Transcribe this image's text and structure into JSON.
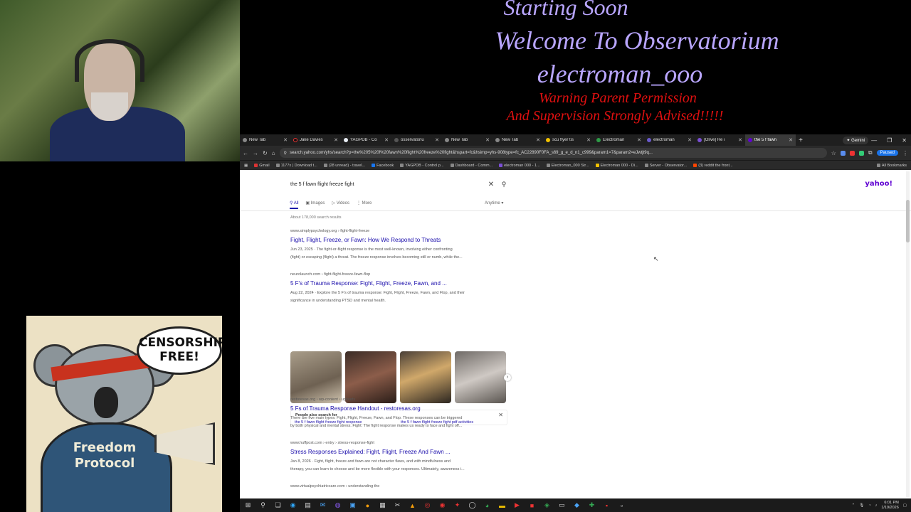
{
  "overlay": {
    "line1": "Starting Soon",
    "line2": "Welcome To Observatorium",
    "line3": "electroman_ooo",
    "line4": "Warning Parent Permission",
    "line5": "And Supervision Strongly Advised!!!!!"
  },
  "poster": {
    "bubble_line1": "CENSORSHIP",
    "bubble_line2": "FREE!",
    "hoodie_line1": "Freedom",
    "hoodie_line2": "Protocol"
  },
  "browser": {
    "tabs": [
      {
        "title": "New Tab",
        "icon": "new-tab-icon",
        "active": false
      },
      {
        "title": "Jake Davies",
        "icon": "tiktok-icon",
        "active": false
      },
      {
        "title": "YAGPDB - Co",
        "icon": "yagpdb-icon",
        "active": false
      },
      {
        "title": "osservatoriu",
        "icon": "site-icon",
        "active": false
      },
      {
        "title": "New Tab",
        "icon": "new-tab-icon",
        "active": false
      },
      {
        "title": "New Tab",
        "icon": "new-tab-icon",
        "active": false
      },
      {
        "title": "scu flyer tis",
        "icon": "yahoo-search-icon",
        "active": false
      },
      {
        "title": "Electroman",
        "icon": "site-icon",
        "active": false
      },
      {
        "title": "electroman",
        "icon": "site-icon",
        "active": false
      },
      {
        "title": "[Olive] Re i",
        "icon": "site-icon",
        "active": false
      },
      {
        "title": "the 5 f fawn",
        "icon": "yahoo-icon",
        "active": true
      }
    ],
    "gemini_label": "Gemini",
    "address": "search.yahoo.com/yhs/search?p=the%205%20f%20fawn%20flight%20freeze%20fight&hspart=fc&hsimp=yhs-908type=fc_AC22890F0FA_s69_g_e_d_n1_c999&param1=7&param2=eJwtjt9q...",
    "paused_label": "Paused",
    "bookmarks": [
      "Gmail",
      "1177x | Download t...",
      "(28 unread) - travel...",
      "Facebook",
      "YAGPDB - Control p...",
      "Dashboard - Comm...",
      "electroman 000 - 1...",
      "Electroman_000 Str...",
      "Electroman 000 - Di...",
      "Server - Observator...",
      "(3) reddit the front..."
    ],
    "all_bookmarks_label": "All Bookmarks"
  },
  "search": {
    "query": "the 5 f fawn flight freeze fight",
    "logo": "yahoo!",
    "filters": [
      "All",
      "Images",
      "Videos",
      "More"
    ],
    "anytime": "Anytime",
    "result_count": "About 178,000 search results",
    "results": [
      {
        "url": "www.simplypsychology.org › fight-flight-freeze",
        "title": "Fight, Flight, Freeze, or Fawn: How We Respond to Threats",
        "snippet1": "Jun 23, 2025 · The fight-or-flight response is the most well-known, involving either confronting",
        "snippet2": "(fight) or escaping (flight) a threat. The freeze response involves becoming still or numb, while the..."
      },
      {
        "url": "neurolaunch.com › fight-flight-freeze-fawn-flop",
        "title": "5 F's of Trauma Response: Fight, Flight, Freeze, Fawn, and ...",
        "snippet1": "Aug 22, 2024 · Explore the 5 F's of trauma response: Fight, Flight, Freeze, Fawn, and Flop, and their",
        "snippet2": "significance in understanding PTSD and mental health."
      },
      {
        "url": "restoresas.org › wp-content › uploads",
        "title": "5 Fs of Trauma Response Handout - restoresas.org",
        "snippet1": "There are five main types: Fight, Flight, Freeze, Fawn, and Flop. These responses can be triggered",
        "snippet2": "by both physical and mental stress. Fight: The fight response makes us ready to face and fight off..."
      },
      {
        "url": "www.huffpost.com › entry › stress-response-fight",
        "title": "Stress Responses Explained: Fight, Flight, Freeze And Fawn ...",
        "snippet1": "Jan 8, 2026 · Fight, flight, freeze and fawn are not character flaws, and with mindfulness and",
        "snippet2": "therapy, you can learn to choose and be more flexible with your responses. Ultimately, awareness i..."
      },
      {
        "url": "www.virtualpsychiatriccare.com › understanding the",
        "title": "",
        "snippet1": "",
        "snippet2": ""
      }
    ],
    "people_also_search": {
      "heading": "People also search for",
      "items": [
        "the 5 f fawn flight freeze fight response",
        "the 5 f fawn flight freeze fight pdf activities"
      ]
    }
  },
  "taskbar": {
    "time": "6:01 PM",
    "date": "1/19/2026"
  }
}
